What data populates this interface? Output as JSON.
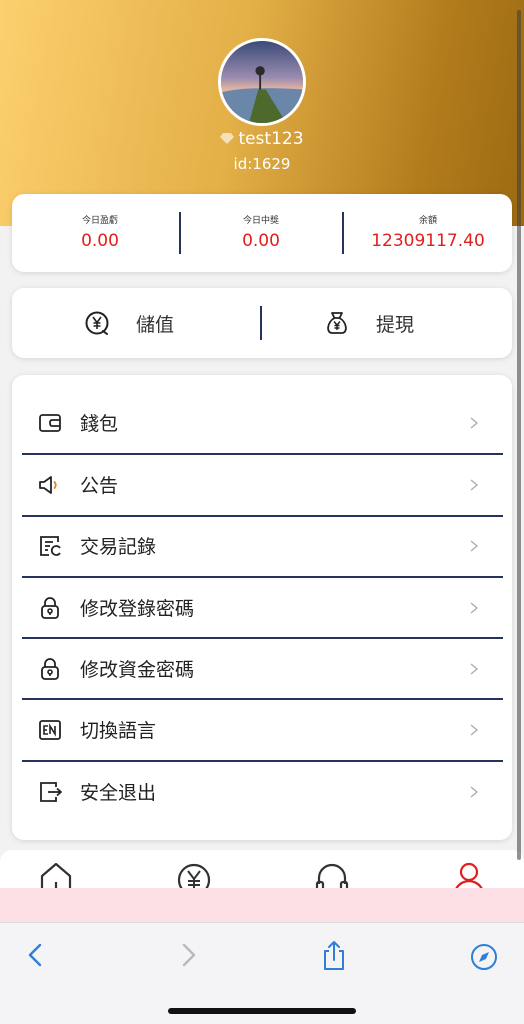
{
  "profile": {
    "username": "test123",
    "id_text": "id:1629"
  },
  "stats": [
    {
      "label": "今日盈虧",
      "value": "0.00"
    },
    {
      "label": "今日中獎",
      "value": "0.00"
    },
    {
      "label": "余額",
      "value": "12309117.40"
    }
  ],
  "actions": {
    "deposit": "儲值",
    "withdraw": "提現"
  },
  "menu": [
    {
      "label": "錢包",
      "icon": "wallet-icon"
    },
    {
      "label": "公告",
      "icon": "speaker-icon"
    },
    {
      "label": "交易記錄",
      "icon": "records-icon"
    },
    {
      "label": "修改登錄密碼",
      "icon": "lock-icon"
    },
    {
      "label": "修改資金密碼",
      "icon": "lock-icon"
    },
    {
      "label": "切換語言",
      "icon": "language-en-icon"
    },
    {
      "label": "安全退出",
      "icon": "logout-icon"
    }
  ],
  "tabbar": [
    "home-icon",
    "yen-icon",
    "headset-icon",
    "user-icon"
  ],
  "colors": {
    "accent": "#e0201f",
    "navy": "#26335f",
    "gold": "#e3af47"
  }
}
